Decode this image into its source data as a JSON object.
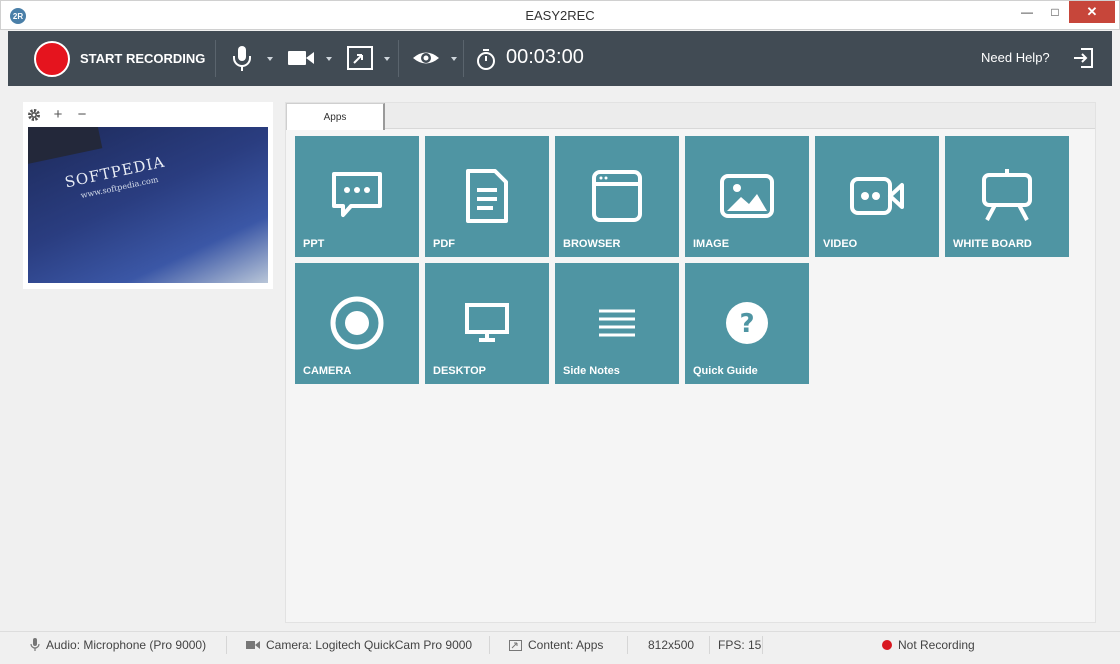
{
  "window": {
    "title": "EASY2REC",
    "logo_text": "2R",
    "minimize_glyph": "—",
    "maximize_glyph": "□",
    "close_glyph": "✕"
  },
  "toolbar": {
    "record_label": "START RECORDING",
    "timer": "00:03:00",
    "help_label": "Need Help?",
    "icons": [
      "microphone-icon",
      "video-camera-icon",
      "screen-region-icon",
      "eye-icon",
      "stopwatch-icon",
      "exit-icon"
    ]
  },
  "webcam": {
    "tools": [
      "gear-icon",
      "+",
      "−"
    ],
    "preview_brand": "SOFTPEDIA",
    "preview_url": "www.softpedia.com"
  },
  "apps": {
    "tab_label": "Apps",
    "tiles": [
      {
        "label": "PPT",
        "icon": "presentation-chat-icon"
      },
      {
        "label": "PDF",
        "icon": "document-icon"
      },
      {
        "label": "BROWSER",
        "icon": "browser-window-icon"
      },
      {
        "label": "IMAGE",
        "icon": "image-icon"
      },
      {
        "label": "VIDEO",
        "icon": "video-icon"
      },
      {
        "label": "WHITE BOARD",
        "icon": "easel-icon"
      },
      {
        "label": "CAMERA",
        "icon": "camera-record-icon"
      },
      {
        "label": "DESKTOP",
        "icon": "monitor-icon"
      },
      {
        "label": "Side Notes",
        "icon": "lines-icon"
      },
      {
        "label": "Quick Guide",
        "icon": "question-icon"
      }
    ]
  },
  "statusbar": {
    "audio": "Audio: Microphone (Pro 9000)",
    "camera": "Camera: Logitech QuickCam Pro 9000",
    "content": "Content: Apps",
    "resolution": "812x500",
    "fps": "FPS: 15",
    "recording_status": "Not Recording"
  },
  "colors": {
    "toolbar_bg": "#414b54",
    "record_red": "#e5141e",
    "tile_teal": "#4f95a3",
    "close_red": "#c7463a"
  }
}
